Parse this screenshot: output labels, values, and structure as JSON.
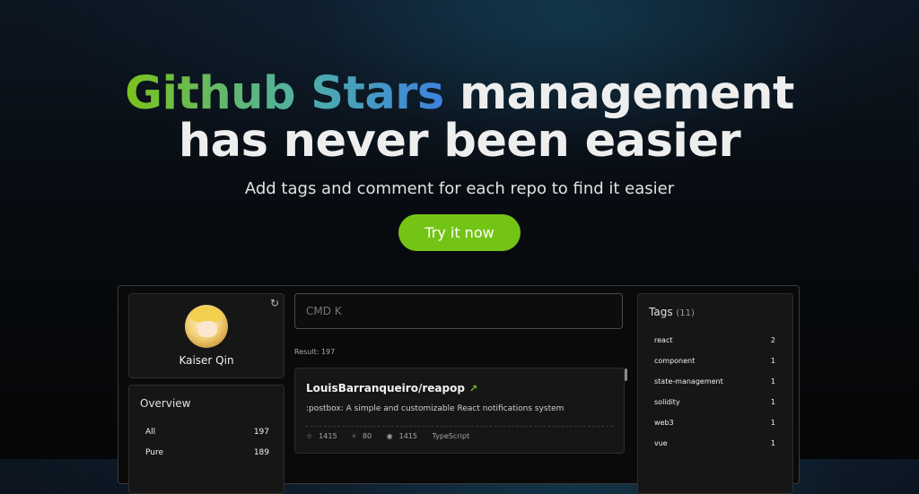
{
  "hero": {
    "headline_gradient": "Github Stars",
    "headline_rest": " management",
    "headline_line2": "has never been easier",
    "subtitle": "Add tags and comment for each repo to find it easier",
    "cta_label": "Try it now"
  },
  "colors": {
    "accent": "#74c416",
    "gradient_start": "#7cc31d",
    "gradient_end": "#3d82e0"
  },
  "profile": {
    "username": "Kaiser Qin",
    "refresh_icon": "refresh-icon"
  },
  "overview": {
    "title": "Overview",
    "items": [
      {
        "label": "All",
        "count": "197"
      },
      {
        "label": "Pure",
        "count": "189"
      }
    ]
  },
  "search": {
    "value": "",
    "placeholder": "CMD K"
  },
  "results": {
    "label": "Result: 197"
  },
  "repo": {
    "name": "LouisBarranqueiro/reapop",
    "link_icon": "arrow-up-right-icon",
    "description": ":postbox: A simple and customizable React notifications system",
    "stars": "1415",
    "forks": "80",
    "watchers": "1415",
    "language": "TypeScript"
  },
  "tags": {
    "title": "Tags",
    "count": "(11)",
    "items": [
      {
        "label": "react",
        "count": "2"
      },
      {
        "label": "component",
        "count": "1"
      },
      {
        "label": "state-management",
        "count": "1"
      },
      {
        "label": "solidity",
        "count": "1"
      },
      {
        "label": "web3",
        "count": "1"
      },
      {
        "label": "vue",
        "count": "1"
      }
    ]
  }
}
